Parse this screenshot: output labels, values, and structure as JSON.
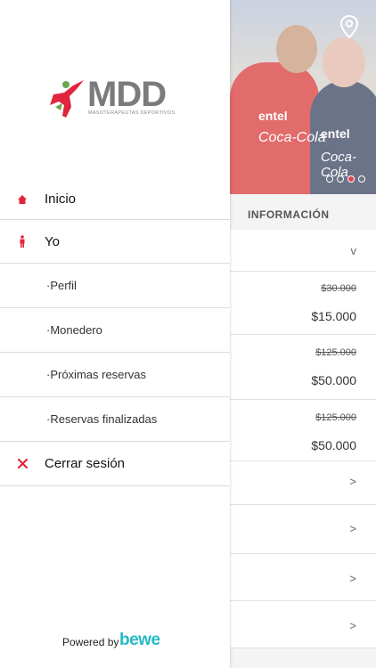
{
  "background": {
    "section_title": "INFORMACIÓN",
    "photo_ads": [
      "entel",
      "Coca-Cola",
      "entel",
      "Coca-Cola"
    ],
    "chevron": "v",
    "prices": [
      {
        "old": "$30.000",
        "new": "$15.000"
      },
      {
        "old": "$125.000",
        "new": "$50.000"
      },
      {
        "old": "$125.000",
        "new": "$50.000"
      }
    ],
    "arrow": ">"
  },
  "drawer": {
    "logo_text": "MDD",
    "logo_subtitle": "MASOTERAPEUTAS DEPORTIVOS",
    "menu": [
      {
        "label": "Inicio",
        "icon": "home-icon"
      },
      {
        "label": "Yo",
        "icon": "person-icon"
      }
    ],
    "submenu": [
      "·Perfil",
      "·Monedero",
      "·Próximas reservas",
      "·Reservas finalizadas"
    ],
    "logout": {
      "label": "Cerrar sesión",
      "icon": "close-icon"
    },
    "powered_by": "Powered by",
    "brand": "bewe"
  },
  "colors": {
    "accent": "#e0263c",
    "brand": "#3a4a6b",
    "brand_accent": "#27b9c7"
  }
}
